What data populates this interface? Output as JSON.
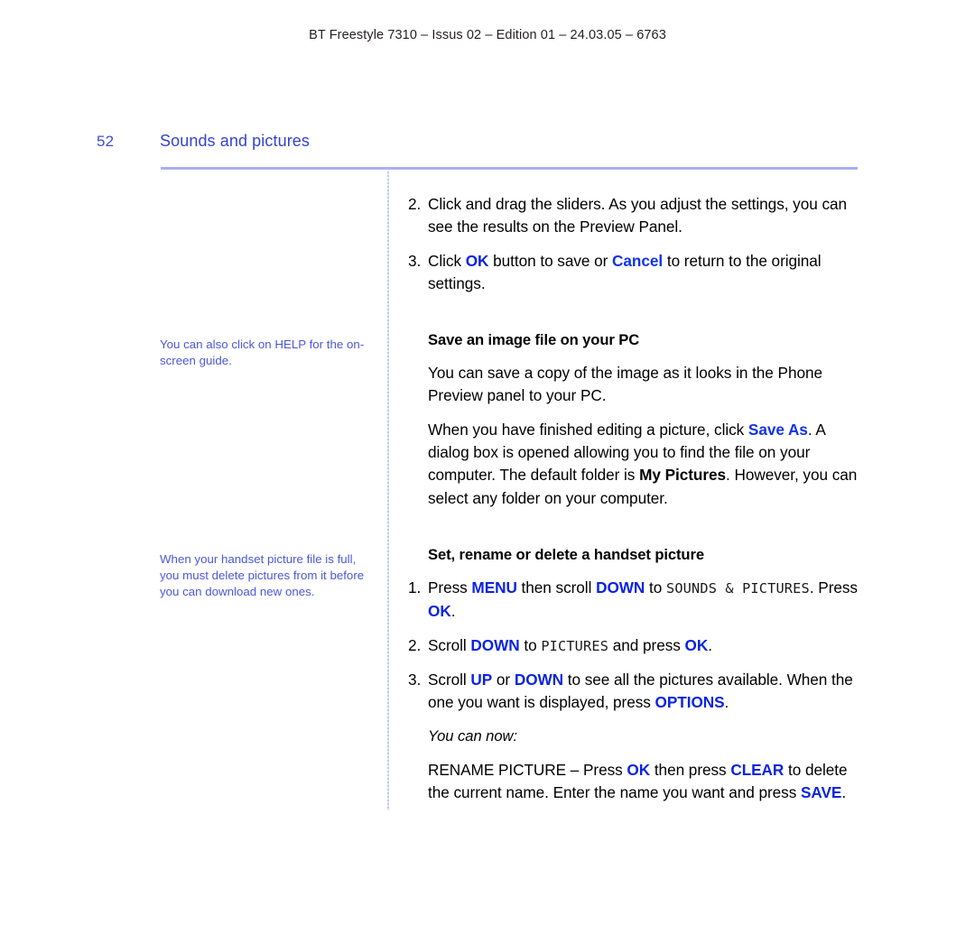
{
  "document": {
    "running_header": "BT Freestyle 7310 – Issus 02 – Edition 01 – 24.03.05 – 6763",
    "page_number": "52",
    "page_title": "Sounds and pictures"
  },
  "colors": {
    "title_blue": "#3344cc",
    "sidenote_blue": "#4a58d8",
    "keyword_blue": "#0a24e0",
    "rule_blue": "#a9aef5"
  },
  "sidenotes": {
    "help": "You can also click on HELP for the on-screen guide.",
    "handset_full": "When your handset picture file is full, you must delete pictures from it before you can download new ones."
  },
  "main": {
    "step2": {
      "num": "2.",
      "t1": "Click and drag the sliders. As you adjust the settings, you can see the results on the Preview Panel."
    },
    "step3": {
      "num": "3.",
      "t1": "Click ",
      "ok": "OK",
      "t2": " button to save or ",
      "cancel": "Cancel",
      "t3": " to return to the original settings."
    },
    "save_section": {
      "heading": "Save an image file on your PC",
      "para1": "You can save a copy of the image as it looks in the Phone Preview panel to your PC.",
      "para2_t1": "When you have finished editing a picture, click ",
      "para2_saveas": "Save As",
      "para2_t2": ". A dialog box is opened allowing you to find the file on your computer. The default folder is ",
      "para2_mypictures": "My Pictures",
      "para2_t3": ". However, you can select any folder on your computer."
    },
    "set_section": {
      "heading": "Set, rename or delete a handset picture",
      "step1": {
        "num": "1.",
        "t1": "Press ",
        "menu": "MENU",
        "t2": " then scroll ",
        "down": "DOWN",
        "t3": " to ",
        "lcd": "SOUNDS & PICTURES",
        "t4": ". Press ",
        "ok": "OK",
        "t5": "."
      },
      "step2": {
        "num": "2.",
        "t1": "Scroll ",
        "down": "DOWN",
        "t2": " to ",
        "lcd": "PICTURES",
        "t3": " and press ",
        "ok": "OK",
        "t4": "."
      },
      "step3": {
        "num": "3.",
        "t1": "Scroll ",
        "up": "UP",
        "t2": " or ",
        "down": "DOWN",
        "t3": " to see all the pictures available. When the one you want is displayed, press ",
        "options": "OPTIONS",
        "t4": "."
      },
      "you_can_now": "You can now:",
      "rename": {
        "t1": "RENAME PICTURE – Press ",
        "ok": "OK",
        "t2": " then press ",
        "clear": "CLEAR",
        "t3": " to delete the current name. Enter the name you want and press ",
        "save": "SAVE",
        "t4": "."
      }
    }
  }
}
